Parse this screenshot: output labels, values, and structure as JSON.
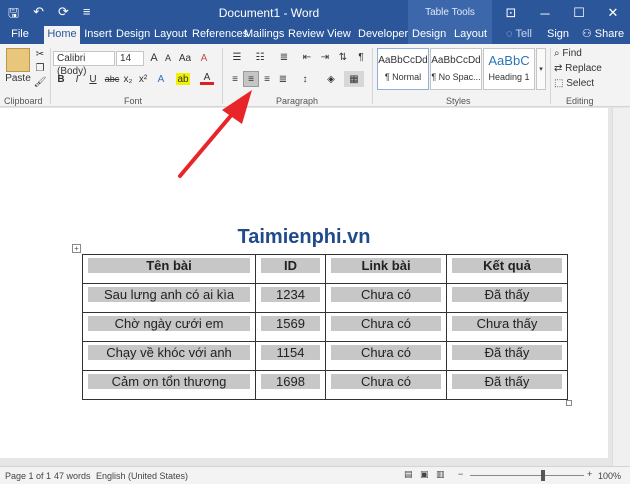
{
  "titlebar": {
    "doc_title": "Document1 - Word",
    "table_tools": "Table Tools",
    "qat_save": "🖫",
    "qat_undo": "↶",
    "qat_redo": "⟳",
    "qat_more": "≡",
    "ribbon_toggle": "⊡",
    "minimize": "─",
    "maximize": "☐",
    "close": "✕"
  },
  "tabs": {
    "file": "File",
    "home": "Home",
    "insert": "Insert",
    "design": "Design",
    "layout": "Layout",
    "references": "References",
    "mailings": "Mailings",
    "review": "Review",
    "view": "View",
    "developer": "Developer",
    "table_design": "Design",
    "table_layout": "Layout",
    "tell_me": "Tell me",
    "sign_in": "Sign in",
    "share": "Share"
  },
  "ribbon": {
    "paste_label": "Paste",
    "font_name": "Calibri (Body)",
    "font_size": "14",
    "bold": "B",
    "italic": "I",
    "underline": "U",
    "strikethrough": "abc",
    "subscript": "x₂",
    "superscript": "x²",
    "grow_font": "A",
    "shrink_font": "A",
    "change_case": "Aa",
    "clear_format": "A",
    "text_effects": "A",
    "highlight": "ab",
    "font_color": "A",
    "show_marks": "¶",
    "group_clipboard": "Clipboard",
    "group_font": "Font",
    "group_paragraph": "Paragraph",
    "group_styles": "Styles",
    "group_editing": "Editing",
    "styles": [
      {
        "sample": "AaBbCcDd",
        "name": "¶ Normal"
      },
      {
        "sample": "AaBbCcDd",
        "name": "¶ No Spac..."
      },
      {
        "sample": "AaBbC",
        "name": "Heading 1"
      }
    ],
    "find": "Find",
    "replace": "Replace",
    "select": "Select"
  },
  "document": {
    "brand": "Taimienphi.vn",
    "table": {
      "headers": [
        "Tên bài",
        "ID",
        "Link bài",
        "Kết quả"
      ],
      "rows": [
        [
          "Sau lưng anh có ai kìa",
          "1234",
          "Chưa có",
          "Đã thấy"
        ],
        [
          "Chờ ngày cưới em",
          "1569",
          "Chưa có",
          "Chưa thấy"
        ],
        [
          "Chạy về khóc với anh",
          "1154",
          "Chưa có",
          "Đã thấy"
        ],
        [
          "Cảm ơn tổn thương",
          "1698",
          "Chưa có",
          "Đã thấy"
        ]
      ]
    }
  },
  "status": {
    "page": "Page 1 of 1",
    "words": "47 words",
    "language": "English (United States)",
    "zoom": "100%"
  },
  "colors": {
    "accent": "#2b579a",
    "arrow": "#e8262a",
    "cell_shading": "#c7c7c7"
  }
}
